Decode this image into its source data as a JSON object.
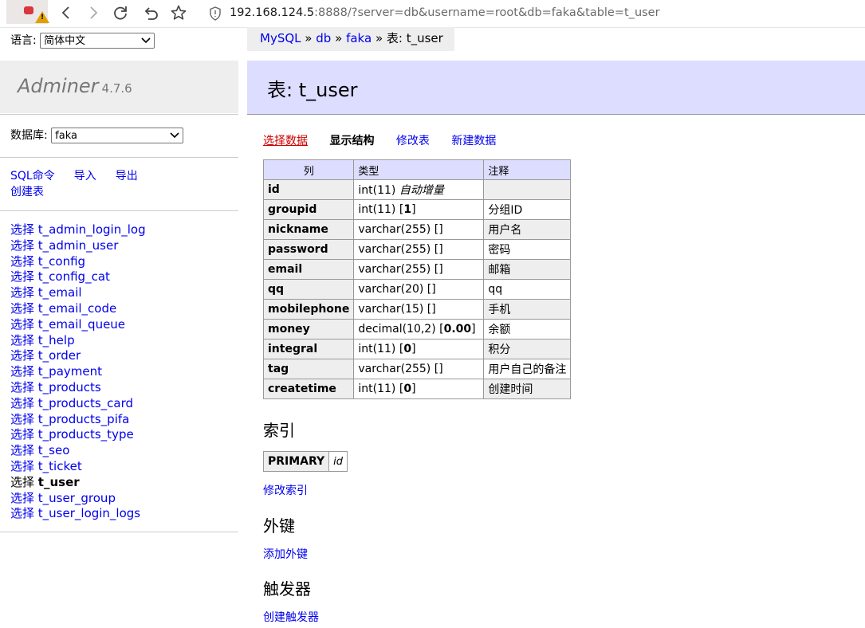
{
  "browser": {
    "url_host": "192.168.124.5",
    "url_rest": ":8888/?server=db&username=root&db=faka&table=t_user"
  },
  "sidebar": {
    "lang_label": "语言:",
    "lang_value": "简体中文",
    "brand": "Adminer",
    "version": "4.7.6",
    "db_label": "数据库:",
    "db_value": "faka",
    "links": {
      "sql": "SQL命令",
      "import": "导入",
      "export": "导出",
      "create_table": "创建表"
    },
    "table_prefix": "选择",
    "tables": [
      "t_admin_login_log",
      "t_admin_user",
      "t_config",
      "t_config_cat",
      "t_email",
      "t_email_code",
      "t_email_queue",
      "t_help",
      "t_order",
      "t_payment",
      "t_products",
      "t_products_card",
      "t_products_pifa",
      "t_products_type",
      "t_seo",
      "t_ticket",
      "t_user",
      "t_user_group",
      "t_user_login_logs"
    ],
    "active_table": "t_user"
  },
  "breadcrumb": {
    "server": "MySQL",
    "sep": "»",
    "host": "db",
    "db": "faka",
    "current": "表: t_user"
  },
  "page": {
    "title": "表: t_user",
    "tabs": {
      "select": "选择数据",
      "structure": "显示结构",
      "alter": "修改表",
      "new_item": "新建数据"
    },
    "columns_header": [
      "列",
      "类型",
      "注释"
    ],
    "columns": [
      {
        "name": "id",
        "type": "int(11)",
        "extra": "自动增量",
        "default": "",
        "comment": ""
      },
      {
        "name": "groupid",
        "type": "int(11)",
        "extra": "",
        "default": "1",
        "comment": "分组ID"
      },
      {
        "name": "nickname",
        "type": "varchar(255)",
        "extra": "",
        "default": "",
        "comment": "用户名"
      },
      {
        "name": "password",
        "type": "varchar(255)",
        "extra": "",
        "default": "",
        "comment": "密码"
      },
      {
        "name": "email",
        "type": "varchar(255)",
        "extra": "",
        "default": "",
        "comment": "邮箱"
      },
      {
        "name": "qq",
        "type": "varchar(20)",
        "extra": "",
        "default": "",
        "comment": "qq"
      },
      {
        "name": "mobilephone",
        "type": "varchar(15)",
        "extra": "",
        "default": "",
        "comment": "手机"
      },
      {
        "name": "money",
        "type": "decimal(10,2)",
        "extra": "",
        "default": "0.00",
        "comment": "余额"
      },
      {
        "name": "integral",
        "type": "int(11)",
        "extra": "",
        "default": "0",
        "comment": "积分"
      },
      {
        "name": "tag",
        "type": "varchar(255)",
        "extra": "",
        "default": "",
        "comment": "用户自己的备注"
      },
      {
        "name": "createtime",
        "type": "int(11)",
        "extra": "",
        "default": "0",
        "comment": "创建时间"
      }
    ],
    "indexes_title": "索引",
    "index_type": "PRIMARY",
    "index_column": "id",
    "alter_indexes": "修改索引",
    "foreign_keys_title": "外键",
    "add_foreign_key": "添加外键",
    "triggers_title": "触发器",
    "add_trigger": "创建触发器"
  }
}
